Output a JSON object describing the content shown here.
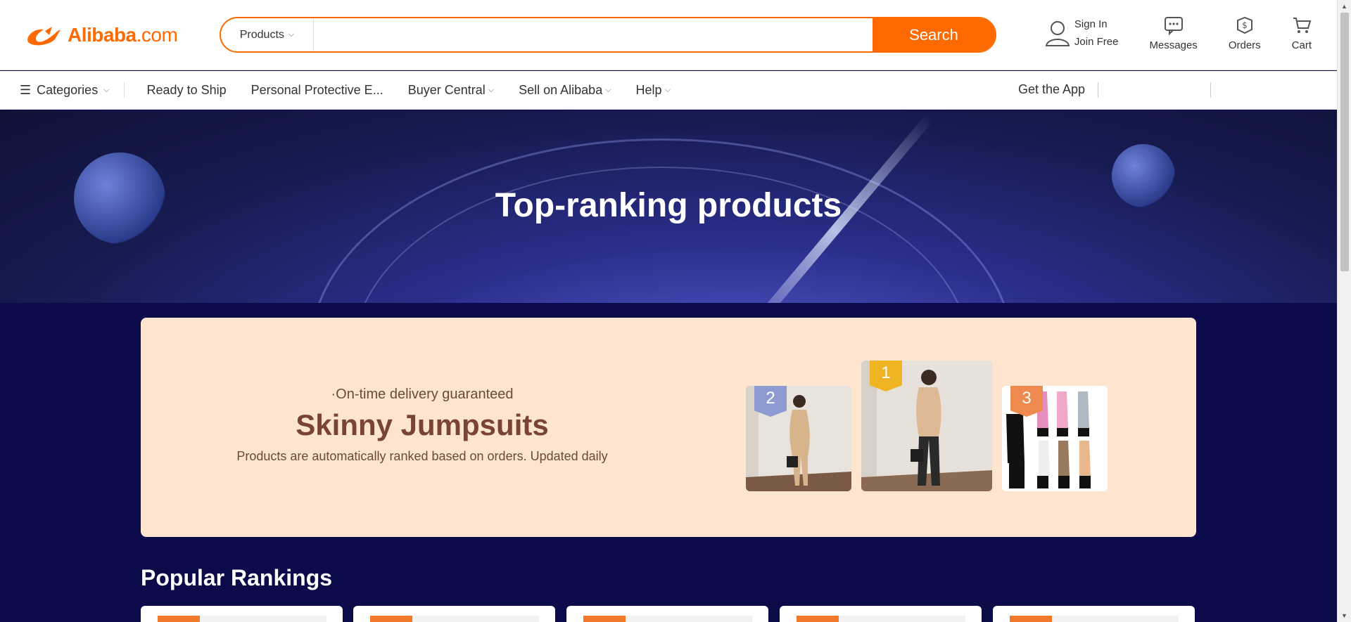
{
  "header": {
    "logo_text": "Alibaba",
    "logo_suffix": ".com",
    "search": {
      "category": "Products",
      "placeholder": "",
      "button": "Search"
    },
    "sign_in": "Sign In",
    "join": "Join Free",
    "messages": "Messages",
    "orders": "Orders",
    "cart": "Cart"
  },
  "nav": {
    "categories": "Categories",
    "ready_to_ship": "Ready to Ship",
    "ppe": "Personal Protective E...",
    "buyer_central": "Buyer Central",
    "sell": "Sell on Alibaba",
    "help": "Help",
    "get_app": "Get the App"
  },
  "banner": {
    "title": "Top-ranking products"
  },
  "feature": {
    "subtitle": "·On-time delivery guaranteed",
    "title": "Skinny Jumpsuits",
    "description": "Products are automatically ranked based on orders. Updated daily",
    "ranks": [
      "1",
      "2",
      "3"
    ]
  },
  "popular": {
    "title": "Popular Rankings"
  },
  "colors": {
    "accent": "#ff6a00",
    "page_bg": "#0b0b4a",
    "feature_bg": "#fde5cf"
  }
}
